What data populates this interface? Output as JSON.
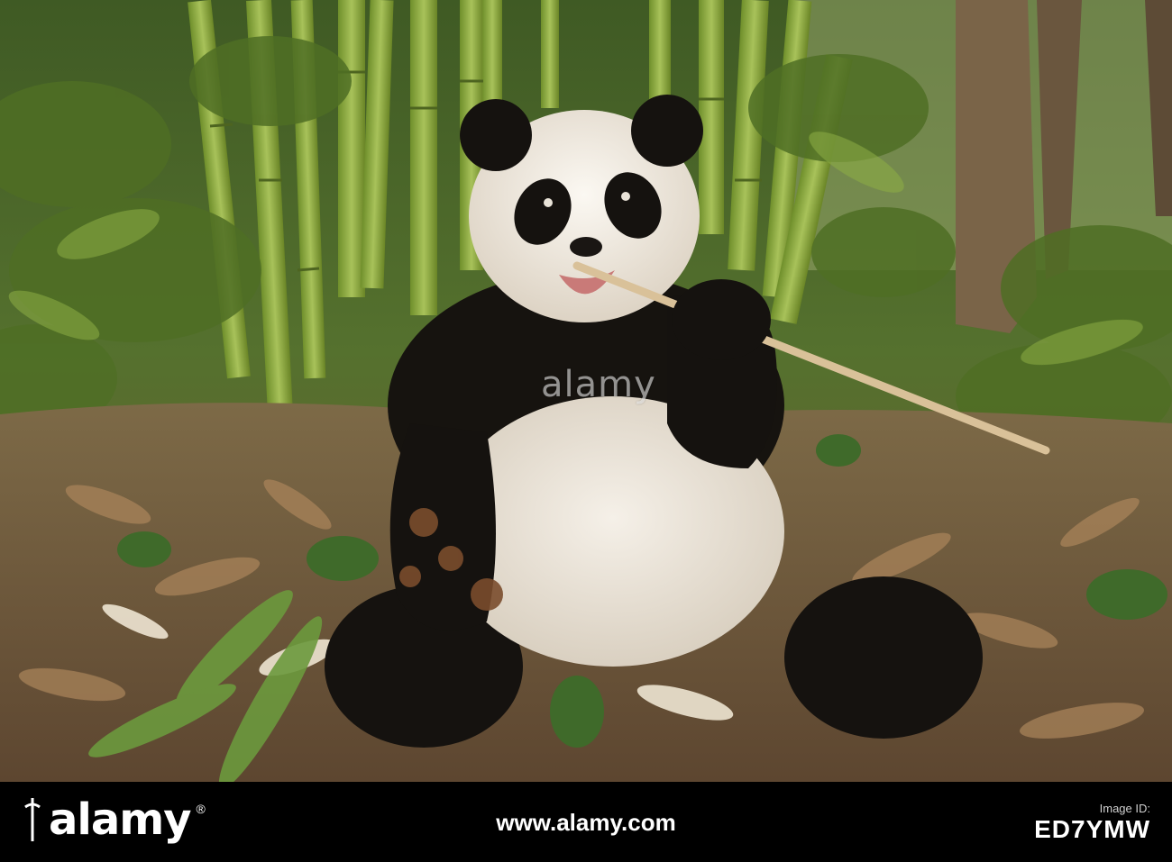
{
  "photo": {
    "subject": "giant-panda-eating-bamboo",
    "colors": {
      "panda_white": "#efe9df",
      "panda_black": "#14110f",
      "bamboo_green": "#8fae3c",
      "leaf_litter": "#8a6a45",
      "forest_shadow": "#2f3a1c"
    }
  },
  "watermark": {
    "text": "alamy"
  },
  "footer": {
    "brand": "alamy",
    "domain": "www.alamy.com",
    "image_id_label": "Image ID:",
    "image_id": "ED7YMW"
  }
}
